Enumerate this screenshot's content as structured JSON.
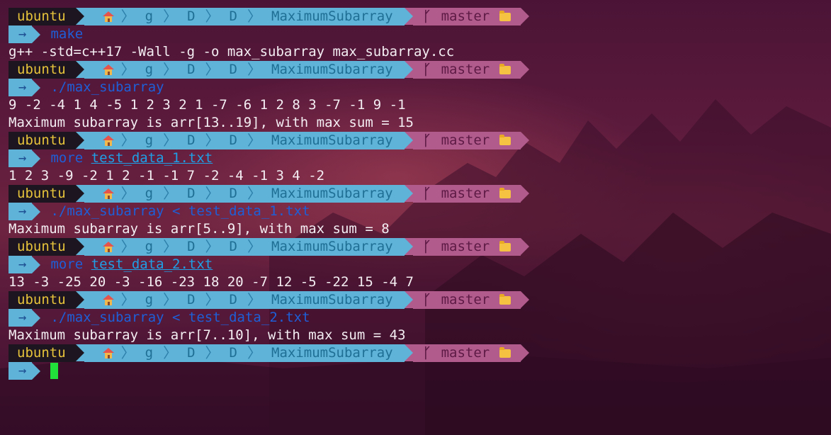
{
  "prompt": {
    "user": "ubuntu",
    "path": [
      "g",
      "D",
      "D",
      "MaximumSubarray"
    ],
    "branch": "master",
    "input_arrow": "→"
  },
  "lines": [
    {
      "type": "prompt"
    },
    {
      "type": "input",
      "cmd": "make",
      "arg": ""
    },
    {
      "type": "output",
      "text": "g++ -std=c++17 -Wall -g -o max_subarray max_subarray.cc"
    },
    {
      "type": "prompt"
    },
    {
      "type": "input",
      "cmd": "./max_subarray",
      "arg": ""
    },
    {
      "type": "output",
      "text": "9 -2 -4 1 4 -5 1 2 3 2 1 -7 -6 1 2 8 3 -7 -1 9 -1"
    },
    {
      "type": "output",
      "text": "Maximum subarray is arr[13..19], with max sum = 15"
    },
    {
      "type": "prompt"
    },
    {
      "type": "input",
      "cmd": "more",
      "arg": "test_data_1.txt",
      "underline": true
    },
    {
      "type": "output",
      "text": "1 2 3 -9 -2 1 2 -1 -1 7 -2 -4 -1 3 4 -2"
    },
    {
      "type": "prompt"
    },
    {
      "type": "input",
      "cmd": "./max_subarray",
      "arg": "< test_data_1.txt"
    },
    {
      "type": "output",
      "text": "Maximum subarray is arr[5..9], with max sum = 8"
    },
    {
      "type": "prompt"
    },
    {
      "type": "input",
      "cmd": "more",
      "arg": "test_data_2.txt",
      "underline": true
    },
    {
      "type": "output",
      "text": "13 -3 -25 20 -3 -16 -23 18 20 -7 12 -5 -22 15 -4 7"
    },
    {
      "type": "prompt"
    },
    {
      "type": "input",
      "cmd": "./max_subarray",
      "arg": "< test_data_2.txt"
    },
    {
      "type": "output",
      "text": "Maximum subarray is arr[7..10], with max sum = 43"
    },
    {
      "type": "prompt"
    },
    {
      "type": "cursor"
    }
  ],
  "colors": {
    "cursor": "#22e03a",
    "prompt_user_bg": "#1d1520",
    "prompt_path_bg": "#5fb3d9",
    "prompt_git_bg": "#b15b8c"
  },
  "icons": {
    "home": "home-icon",
    "branch": "git-branch-icon",
    "folder": "folder-icon"
  }
}
